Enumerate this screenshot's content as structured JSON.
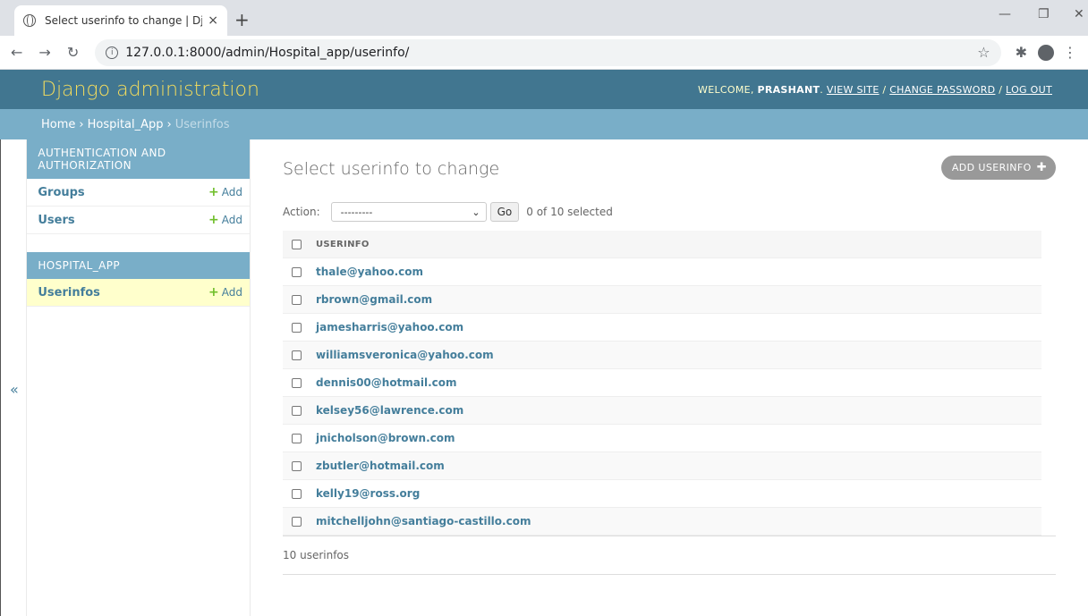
{
  "browser": {
    "tab_title": "Select userinfo to change | Djang",
    "tab_close": "×",
    "new_tab": "+",
    "url": "127.0.0.1:8000/admin/Hospital_app/userinfo/"
  },
  "header": {
    "branding": "Django administration",
    "welcome": "WELCOME,",
    "username": "PRASHANT",
    "view_site": "VIEW SITE",
    "change_password": "CHANGE PASSWORD",
    "log_out": "LOG OUT"
  },
  "breadcrumbs": {
    "home": "Home",
    "app": "Hospital_App",
    "current": "Userinfos"
  },
  "sidebar": {
    "toggle": "«",
    "modules": [
      {
        "caption": "AUTHENTICATION AND AUTHORIZATION",
        "rows": [
          {
            "name": "Groups",
            "add": "Add"
          },
          {
            "name": "Users",
            "add": "Add"
          }
        ]
      },
      {
        "caption": "HOSPITAL_APP",
        "rows": [
          {
            "name": "Userinfos",
            "add": "Add"
          }
        ]
      }
    ]
  },
  "main": {
    "title": "Select userinfo to change",
    "add_button": "ADD USERINFO",
    "action_label": "Action:",
    "action_selected": "---------",
    "go_label": "Go",
    "selected_count": "0 of 10 selected",
    "column_header": "USERINFO",
    "rows": [
      "thale@yahoo.com",
      "rbrown@gmail.com",
      "jamesharris@yahoo.com",
      "williamsveronica@yahoo.com",
      "dennis00@hotmail.com",
      "kelsey56@lawrence.com",
      "jnicholson@brown.com",
      "zbutler@hotmail.com",
      "kelly19@ross.org",
      "mitchelljohn@santiago-castillo.com"
    ],
    "paginator": "10 userinfos"
  }
}
